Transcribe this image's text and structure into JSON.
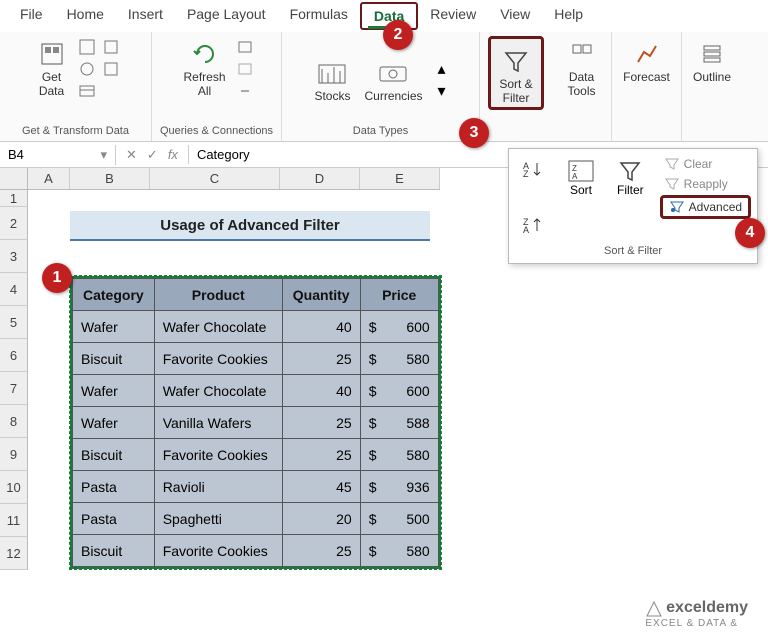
{
  "tabs": [
    "File",
    "Home",
    "Insert",
    "Page Layout",
    "Formulas",
    "Data",
    "Review",
    "View",
    "Help"
  ],
  "active_tab": "Data",
  "ribbon": {
    "get_data": "Get\nData",
    "refresh_all": "Refresh\nAll",
    "group1": "Get & Transform Data",
    "group2": "Queries & Connections",
    "stocks": "Stocks",
    "currencies": "Currencies",
    "group3": "Data Types",
    "sort_filter": "Sort &\nFilter",
    "data_tools": "Data\nTools",
    "forecast": "Forecast",
    "outline": "Outline"
  },
  "dropdown": {
    "sort": "Sort",
    "filter": "Filter",
    "clear": "Clear",
    "reapply": "Reapply",
    "advanced": "Advanced",
    "footer": "Sort & Filter"
  },
  "namebox": "B4",
  "formula": "Category",
  "title": "Usage of Advanced Filter",
  "columns": [
    "A",
    "B",
    "C",
    "D",
    "E"
  ],
  "row_nums": [
    "1",
    "2",
    "3",
    "4",
    "5",
    "6",
    "7",
    "8",
    "9",
    "10",
    "11",
    "12"
  ],
  "headers": [
    "Category",
    "Product",
    "Quantity",
    "Price"
  ],
  "rows": [
    {
      "cat": "Wafer",
      "prod": "Wafer Chocolate",
      "qty": "40",
      "cur": "$",
      "price": "600"
    },
    {
      "cat": "Biscuit",
      "prod": "Favorite Cookies",
      "qty": "25",
      "cur": "$",
      "price": "580"
    },
    {
      "cat": "Wafer",
      "prod": "Wafer Chocolate",
      "qty": "40",
      "cur": "$",
      "price": "600"
    },
    {
      "cat": "Wafer",
      "prod": "Vanilla Wafers",
      "qty": "25",
      "cur": "$",
      "price": "588"
    },
    {
      "cat": "Biscuit",
      "prod": "Favorite Cookies",
      "qty": "25",
      "cur": "$",
      "price": "580"
    },
    {
      "cat": "Pasta",
      "prod": "Ravioli",
      "qty": "45",
      "cur": "$",
      "price": "936"
    },
    {
      "cat": "Pasta",
      "prod": "Spaghetti",
      "qty": "20",
      "cur": "$",
      "price": "500"
    },
    {
      "cat": "Biscuit",
      "prod": "Favorite Cookies",
      "qty": "25",
      "cur": "$",
      "price": "580"
    }
  ],
  "callouts": {
    "c1": "1",
    "c2": "2",
    "c3": "3",
    "c4": "4"
  },
  "watermark": {
    "brand": "exceldemy",
    "tag": "EXCEL & DATA &"
  }
}
